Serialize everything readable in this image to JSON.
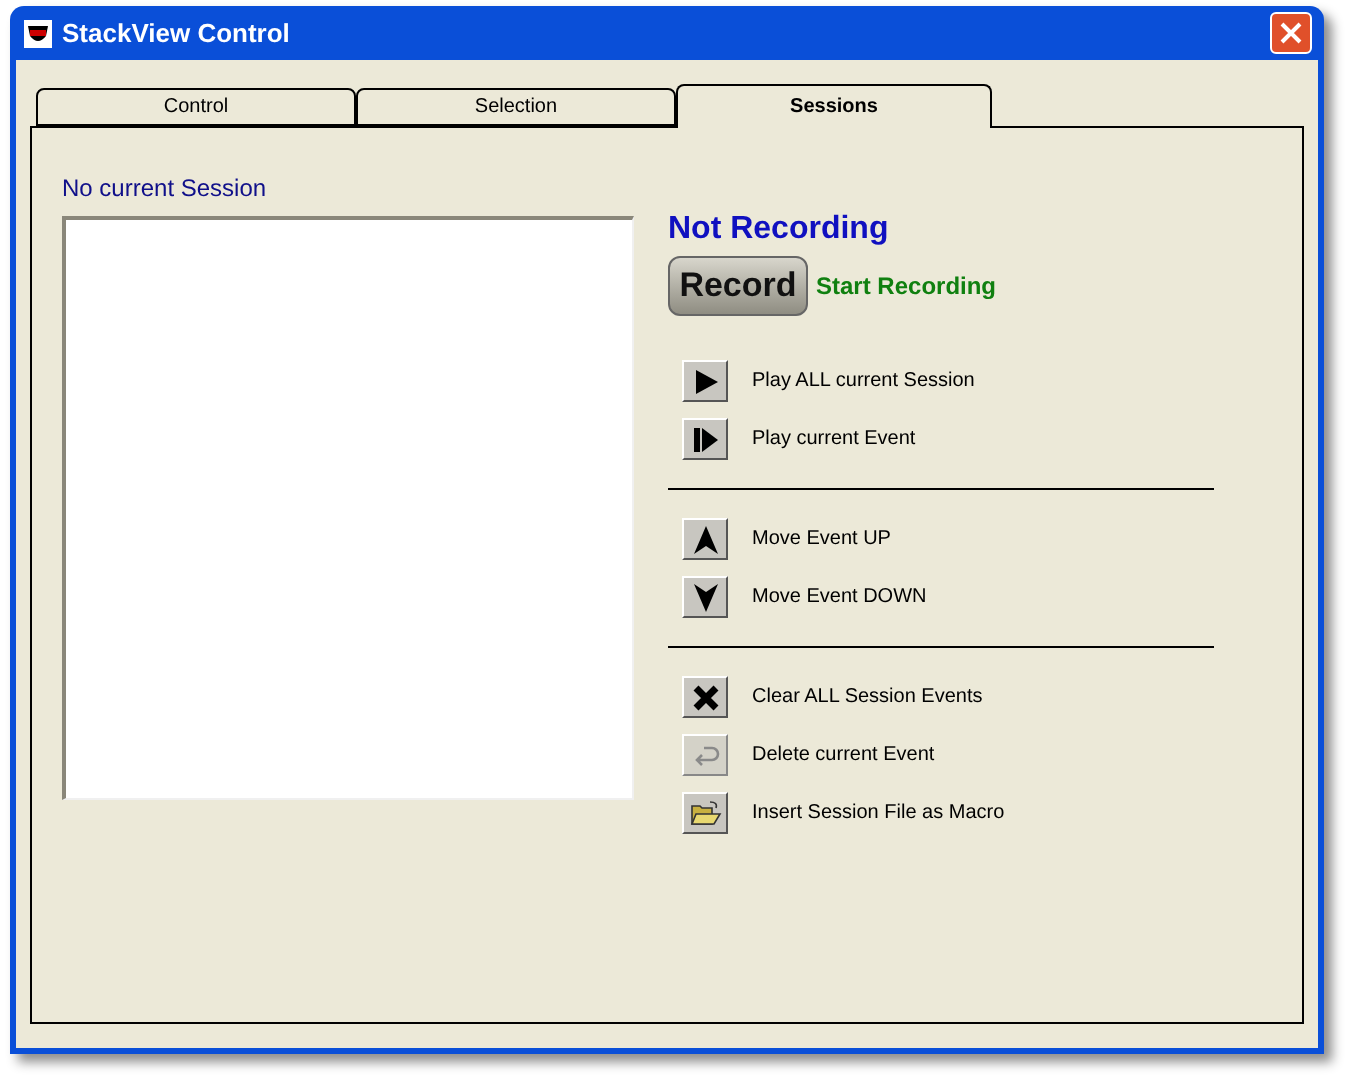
{
  "window": {
    "title": "StackView Control"
  },
  "tabs": [
    {
      "label": "Control",
      "selected": false
    },
    {
      "label": "Selection",
      "selected": false
    },
    {
      "label": "Sessions",
      "selected": true
    }
  ],
  "session_label": "No current Session",
  "recording_status": "Not Recording",
  "record_button": "Record",
  "record_hint": "Start Recording",
  "action_groups": [
    [
      {
        "kind": "play",
        "label": "Play ALL current Session",
        "disabled": false
      },
      {
        "kind": "step",
        "label": "Play current Event",
        "disabled": false
      }
    ],
    [
      {
        "kind": "up",
        "label": "Move Event UP",
        "disabled": false
      },
      {
        "kind": "down",
        "label": "Move Event DOWN",
        "disabled": false
      }
    ],
    [
      {
        "kind": "clear",
        "label": "Clear ALL Session Events",
        "disabled": false
      },
      {
        "kind": "undo",
        "label": "Delete current Event",
        "disabled": true
      },
      {
        "kind": "folder",
        "label": "Insert Session File as Macro",
        "disabled": false
      }
    ]
  ]
}
